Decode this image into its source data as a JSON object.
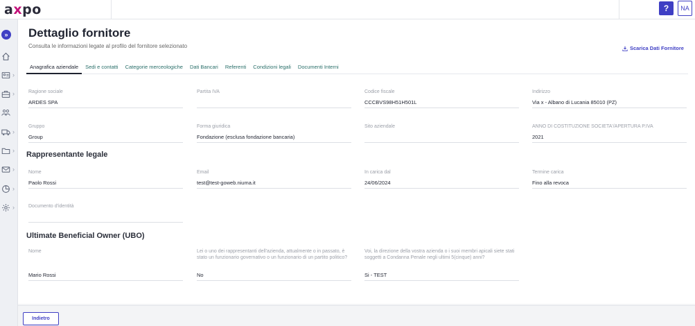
{
  "brand": {
    "logo_prefix": "a",
    "logo_x": "x",
    "logo_suffix": "po"
  },
  "topbar": {
    "help_label": "?",
    "user_initials": "NA"
  },
  "sidebar": {
    "expand_icon": "double-chevron-right-icon",
    "items": [
      {
        "icon": "home-icon",
        "has_submenu": false
      },
      {
        "icon": "id-card-icon",
        "has_submenu": true
      },
      {
        "icon": "briefcase-icon",
        "has_submenu": true
      },
      {
        "icon": "people-icon",
        "has_submenu": false
      },
      {
        "icon": "truck-icon",
        "has_submenu": true
      },
      {
        "icon": "folder-icon",
        "has_submenu": true
      },
      {
        "icon": "mail-icon",
        "has_submenu": true
      },
      {
        "icon": "pie-chart-icon",
        "has_submenu": true
      },
      {
        "icon": "gear-icon",
        "has_submenu": true
      }
    ]
  },
  "header": {
    "title": "Dettaglio fornitore",
    "subtitle": "Consulta le informazioni legate al profilo del fornitore selezionato",
    "download_label": "Scarica Dati Fornitore"
  },
  "tabs": [
    {
      "label": "Anagrafica aziendale",
      "active": true
    },
    {
      "label": "Sedi e contatti",
      "active": false
    },
    {
      "label": "Categorie merceologiche",
      "active": false
    },
    {
      "label": "Dati Bancari",
      "active": false
    },
    {
      "label": "Referenti",
      "active": false
    },
    {
      "label": "Condizioni legali",
      "active": false
    },
    {
      "label": "Documenti Interni",
      "active": false
    }
  ],
  "company": {
    "ragione_sociale": {
      "label": "Ragione sociale",
      "value": "ARDES SPA"
    },
    "partita_iva": {
      "label": "Partita IVA",
      "value": ""
    },
    "codice_fiscale": {
      "label": "Codice fiscale",
      "value": "CCCBVS98H51H501L"
    },
    "indirizzo": {
      "label": "Indirizzo",
      "value": "Via x - Albano di Lucania 85010 (PZ)"
    },
    "gruppo": {
      "label": "Gruppo",
      "value": "Group"
    },
    "forma_giuridica": {
      "label": "Forma giuridica",
      "value": "Fondazione (esclusa fondazione bancaria)"
    },
    "sito_aziendale": {
      "label": "Sito aziendale",
      "value": ""
    },
    "anno_costituzione": {
      "label": "ANNO DI COSTITUZIONE SOCIETA'/APERTURA P.IVA",
      "value": "2021"
    }
  },
  "legal_rep": {
    "section_title": "Rappresentante legale",
    "nome": {
      "label": "Nome",
      "value": "Paolo Rossi"
    },
    "email": {
      "label": "Email",
      "value": "test@test-goweb.niuma.it"
    },
    "in_carica_dal": {
      "label": "In carica dal",
      "value": "24/06/2024"
    },
    "termine_carica": {
      "label": "Termine carica",
      "value": "Fino alla revoca"
    },
    "documento": {
      "label": "Documento d'identità",
      "value": ""
    }
  },
  "ubo": {
    "section_title": "Ultimate Beneficial Owner (UBO)",
    "nome": {
      "label": "Nome",
      "value": "Mario Rossi"
    },
    "funzionario": {
      "label": "Lei o uno dei rappresentanti dell'azienda, attualmente o in passato, è stato un funzionario governativo o un funzionario di un partito politico?",
      "value": "No"
    },
    "condanna": {
      "label": "Voi, la direzione della vostra azienda o i suoi membri apicali siete stati soggetti a Condanna Penale negli ultimi 5(cinque) anni?",
      "value": "Si - TEST"
    }
  },
  "footer": {
    "back_label": "Indietro"
  },
  "colors": {
    "accent": "#3f3fc4",
    "brand_x": "#c3127a",
    "tab_link": "#2a6f6a"
  }
}
